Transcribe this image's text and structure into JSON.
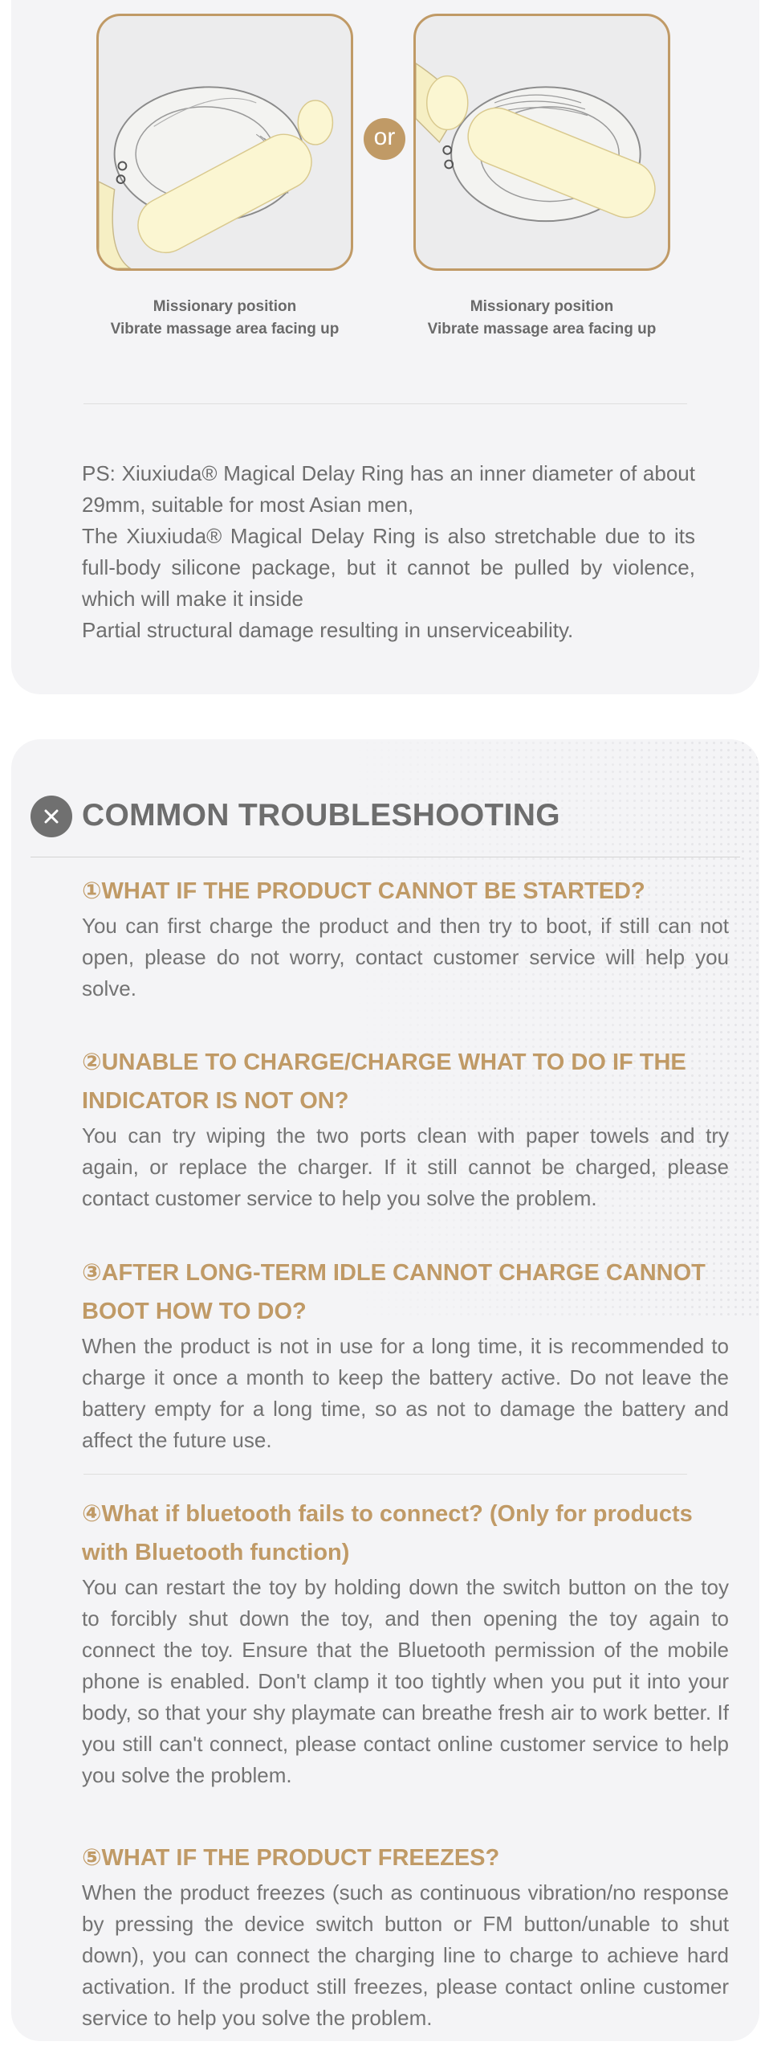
{
  "positions": {
    "left": {
      "caption_line1": "Missionary position",
      "caption_line2": "Vibrate massage area facing up"
    },
    "or_label": "or",
    "right": {
      "caption_line1": "Missionary position",
      "caption_line2": "Vibrate massage area facing up"
    }
  },
  "ps_note": {
    "line1": "PS: Xiuxiuda® Magical Delay Ring has an inner diameter of about 29mm, suitable for most Asian men,",
    "line2": "The Xiuxiuda® Magical Delay Ring is also stretchable due to its full-body silicone package, but it cannot be pulled by violence, which will make it inside",
    "line3": "Partial structural damage resulting in unserviceability."
  },
  "troubleshooting": {
    "title": "COMMON TROUBLESHOOTING",
    "items": [
      {
        "question": "①WHAT IF THE PRODUCT CANNOT BE STARTED?",
        "answer": "You can first charge the product and then try to boot, if still can not open, please do not worry, contact customer service will help you solve."
      },
      {
        "question": "②UNABLE TO CHARGE/CHARGE WHAT TO DO IF THE INDICATOR IS NOT ON?",
        "answer": "You can try wiping the two ports clean with paper towels and try again, or replace the charger. If it still cannot be charged, please contact customer service to help you solve the problem."
      },
      {
        "question": "③AFTER LONG-TERM IDLE CANNOT CHARGE CANNOT BOOT HOW TO DO?",
        "answer": "When the product is not in use for a long time, it is recommended to charge it once a month to keep the battery active. Do not leave the battery empty for a long time, so as not to damage the battery and affect the future use."
      },
      {
        "question": "④What if bluetooth fails to connect? (Only for products with Bluetooth function)",
        "answer": "You can restart the toy by holding down the switch button on the toy to forcibly shut down the toy, and then opening the toy again to connect the toy. Ensure that the Bluetooth permission of the mobile phone is enabled. Don't clamp it too tightly when you put it into your body, so that your shy playmate can breathe fresh air to work better. If you still can't connect, please contact online customer service to help you solve the problem."
      },
      {
        "question": "⑤WHAT IF THE PRODUCT FREEZES?",
        "answer": "When the product freezes (such as continuous vibration/no response by pressing the device switch button or FM button/unable to shut down), you can connect the charging line to charge to achieve hard activation. If the product still freezes, please contact online customer service to help you solve the problem."
      }
    ]
  },
  "colors": {
    "accent_gold": "#c09a66",
    "card_bg": "#f4f4f6",
    "title_gray": "#6d6d6d"
  },
  "icons": {
    "troubleshooting": "close-x-icon"
  }
}
